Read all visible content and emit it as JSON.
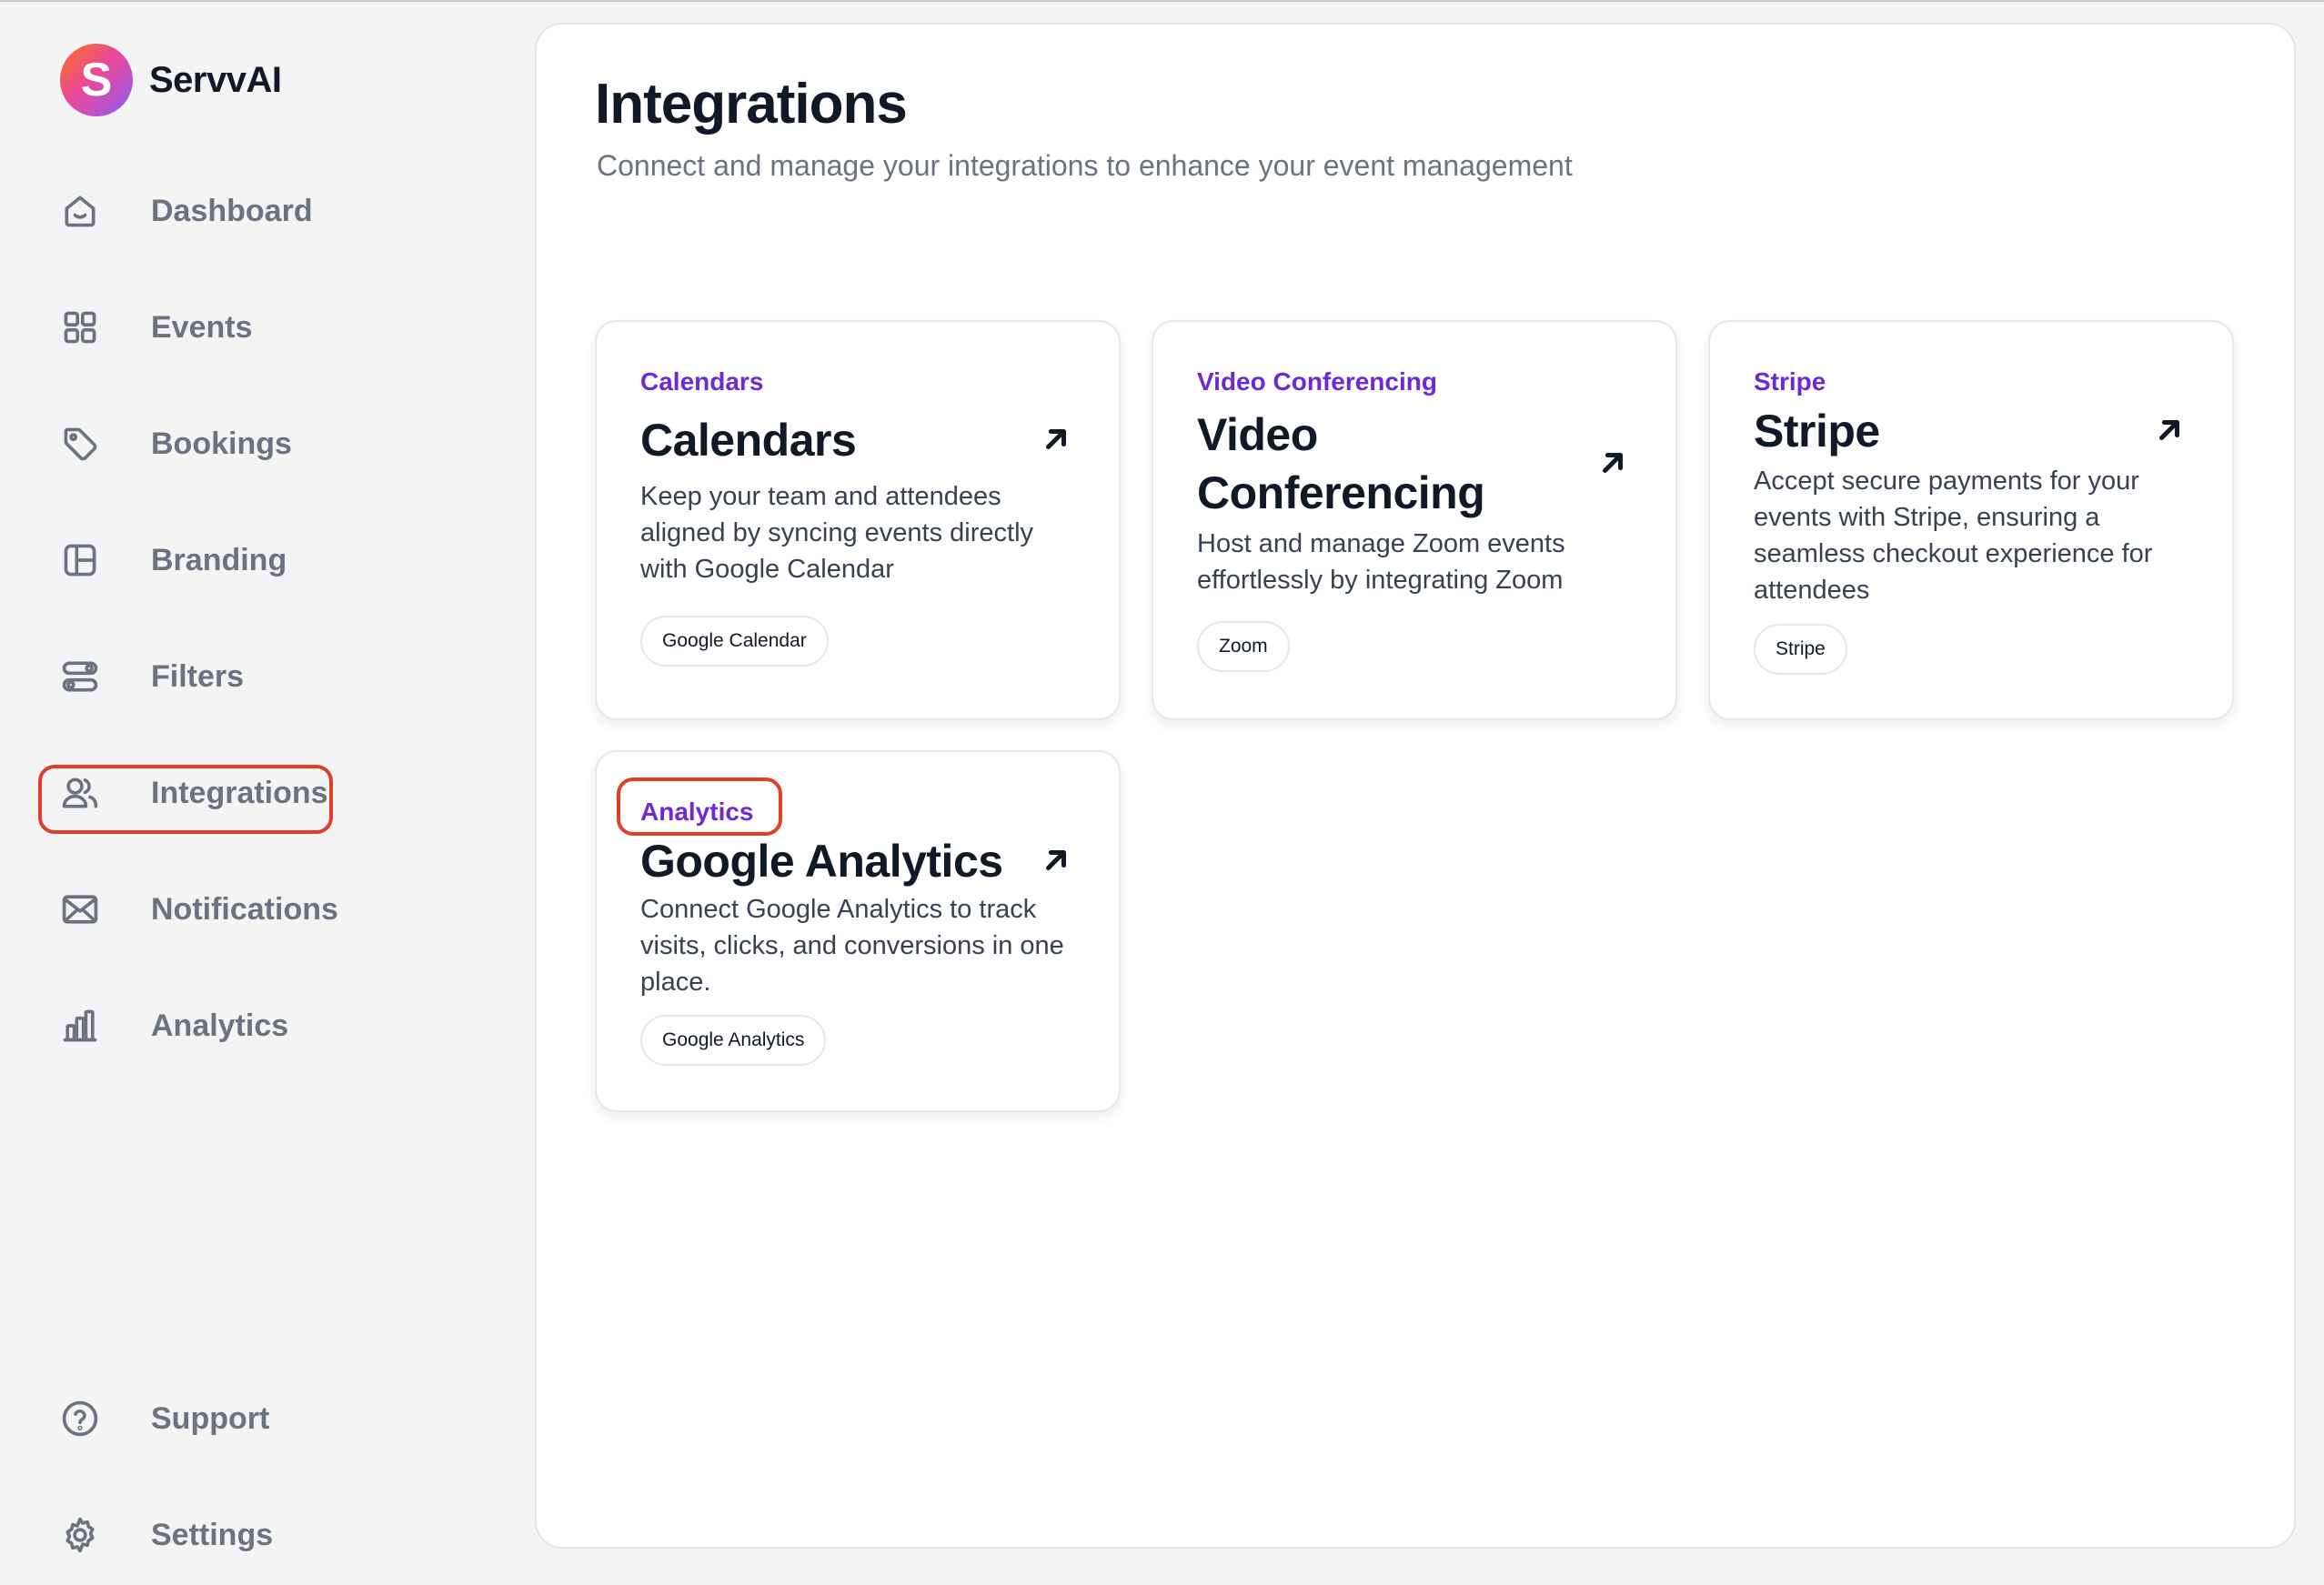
{
  "app": {
    "brand_name": "ServvAI",
    "logo_letter": "S"
  },
  "sidebar": {
    "items": [
      {
        "label": "Dashboard",
        "icon": "home-icon"
      },
      {
        "label": "Events",
        "icon": "grid-icon"
      },
      {
        "label": "Bookings",
        "icon": "tag-icon"
      },
      {
        "label": "Branding",
        "icon": "layout-icon"
      },
      {
        "label": "Filters",
        "icon": "toggles-icon"
      },
      {
        "label": "Integrations",
        "icon": "users-icon",
        "active": true
      },
      {
        "label": "Notifications",
        "icon": "mail-icon"
      },
      {
        "label": "Analytics",
        "icon": "bar-chart-icon"
      }
    ],
    "footer_items": [
      {
        "label": "Support",
        "icon": "help-circle-icon"
      },
      {
        "label": "Settings",
        "icon": "gear-icon"
      }
    ]
  },
  "page": {
    "title": "Integrations",
    "subtitle": "Connect and manage your integrations to enhance your event management"
  },
  "cards": [
    {
      "category": "Calendars",
      "title": "Calendars",
      "description": "Keep your team and attendees aligned by syncing events directly with Google Calendar",
      "tag": "Google Calendar"
    },
    {
      "category": "Video Conferencing",
      "title": "Video Conferencing",
      "description": "Host and manage Zoom events effortlessly by integrating Zoom",
      "tag": "Zoom"
    },
    {
      "category": "Stripe",
      "title": "Stripe",
      "description": "Accept secure payments for your events with Stripe, ensuring a seamless checkout experience for attendees",
      "tag": "Stripe"
    },
    {
      "category": "Analytics",
      "title": "Google Analytics",
      "description": "Connect Google Analytics to track visits, clicks, and conversions in one place.",
      "tag": "Google Analytics"
    }
  ],
  "colors": {
    "accent": "#6d28d9",
    "highlight": "#e0402a",
    "muted_text": "#6b7280"
  }
}
